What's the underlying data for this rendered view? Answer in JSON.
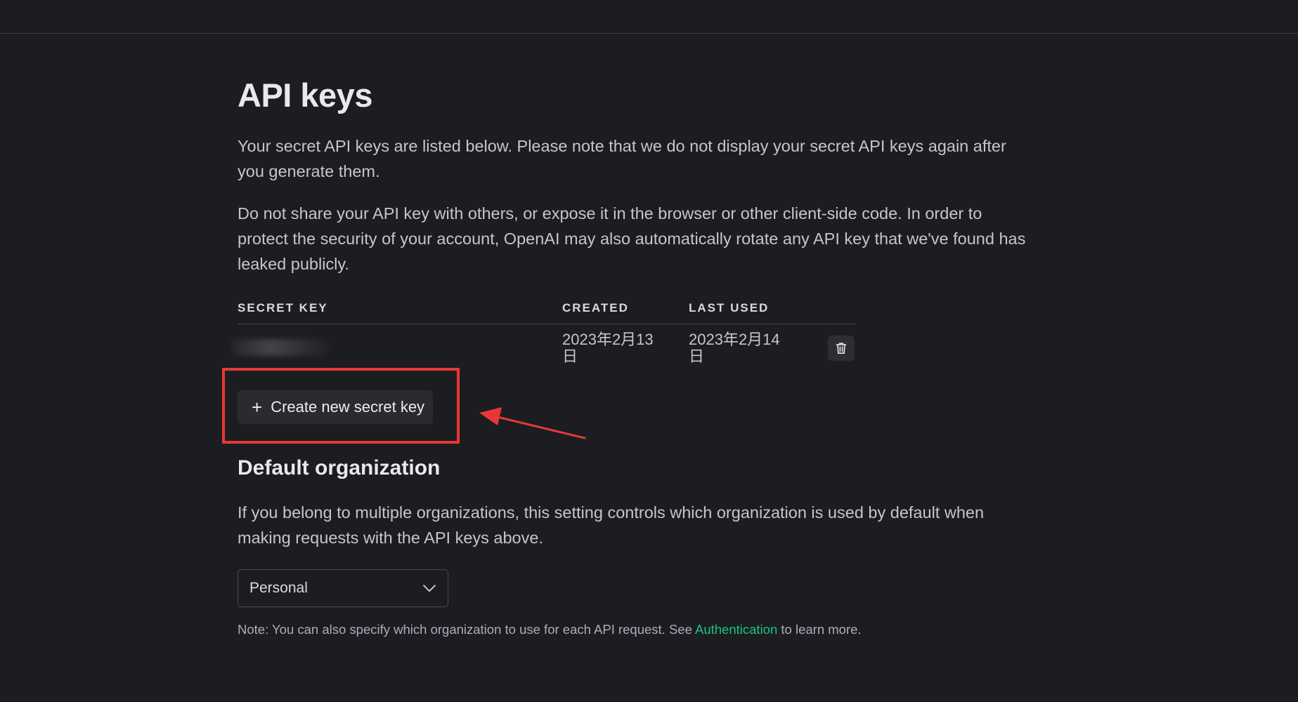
{
  "header": {},
  "page": {
    "title": "API keys",
    "intro_1": "Your secret API keys are listed below. Please note that we do not display your secret API keys again after you generate them.",
    "intro_2": "Do not share your API key with others, or expose it in the browser or other client-side code. In order to protect the security of your account, OpenAI may also automatically rotate any API key that we've found has leaked publicly."
  },
  "keys_table": {
    "columns": [
      "SECRET KEY",
      "CREATED",
      "LAST USED"
    ],
    "rows": [
      {
        "secret_key": "",
        "created": "2023年2月13日",
        "last_used": "2023年2月14日"
      }
    ]
  },
  "create_button": {
    "plus": "+",
    "label": "Create new secret key"
  },
  "default_org": {
    "title": "Default organization",
    "description": "If you belong to multiple organizations, this setting controls which organization is used by default when making requests with the API keys above.",
    "selected": "Personal",
    "note_prefix": "Note: You can also specify which organization to use for each API request. See ",
    "note_link": "Authentication",
    "note_suffix": " to learn more."
  },
  "colors": {
    "background": "#1c1d20",
    "link": "#19c37d",
    "annotation": "#e53935"
  },
  "icons": {
    "delete": "trash-icon",
    "dropdown": "chevron-down-icon",
    "add": "plus-icon"
  }
}
